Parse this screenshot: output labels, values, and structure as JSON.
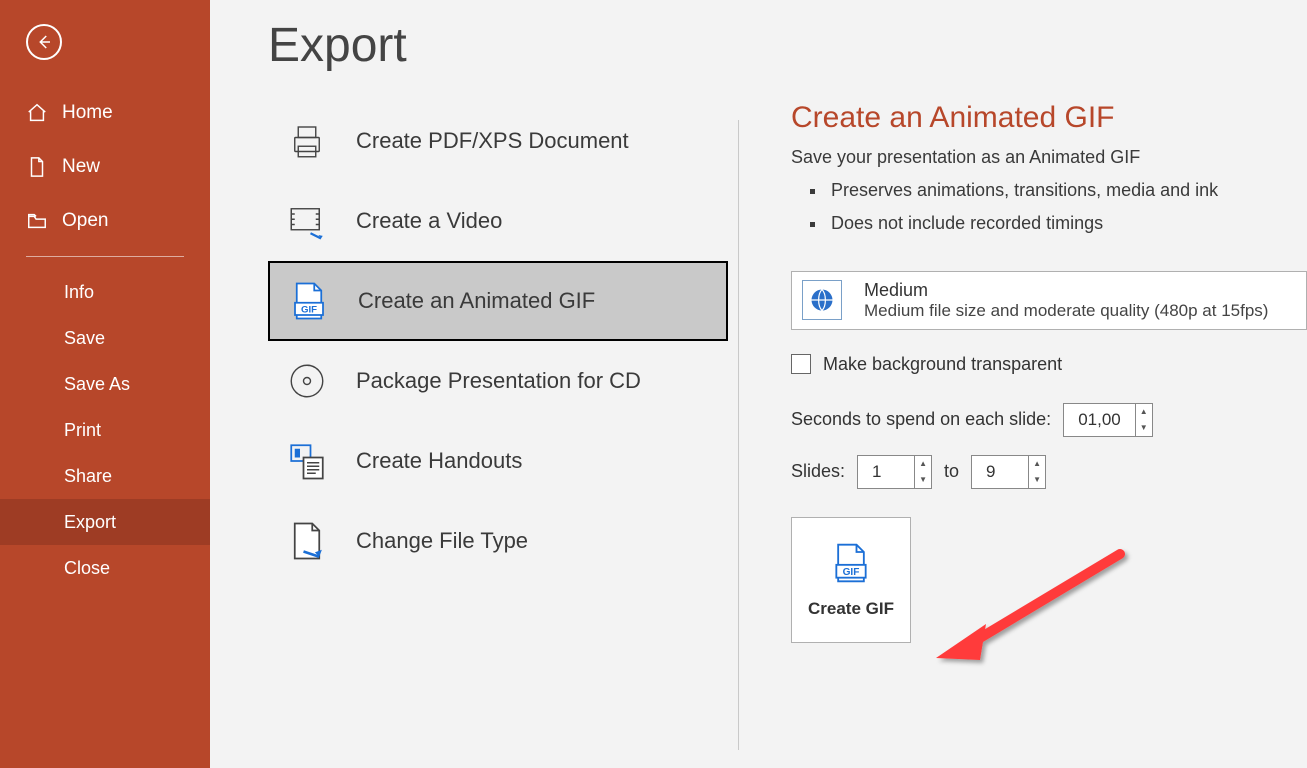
{
  "sidebar": {
    "home": "Home",
    "new": "New",
    "open": "Open",
    "info": "Info",
    "save": "Save",
    "saveAs": "Save As",
    "print": "Print",
    "share": "Share",
    "export": "Export",
    "close": "Close"
  },
  "page": {
    "title": "Export"
  },
  "exportTypes": {
    "pdf": "Create PDF/XPS Document",
    "video": "Create a Video",
    "gif": "Create an Animated GIF",
    "package": "Package Presentation for CD",
    "handouts": "Create Handouts",
    "changeType": "Change File Type"
  },
  "pane": {
    "title": "Create an Animated GIF",
    "desc": "Save your presentation as an Animated GIF",
    "bullet1": "Preserves animations, transitions, media and ink",
    "bullet2": "Does not include recorded timings",
    "quality": {
      "name": "Medium",
      "detail": "Medium file size and moderate quality (480p at 15fps)"
    },
    "transparentLabel": "Make background transparent",
    "secondsLabel": "Seconds to spend on each slide:",
    "secondsValue": "01,00",
    "slidesLabel": "Slides:",
    "slideFrom": "1",
    "slideToLabel": "to",
    "slideTo": "9",
    "createBtn": "Create GIF"
  }
}
